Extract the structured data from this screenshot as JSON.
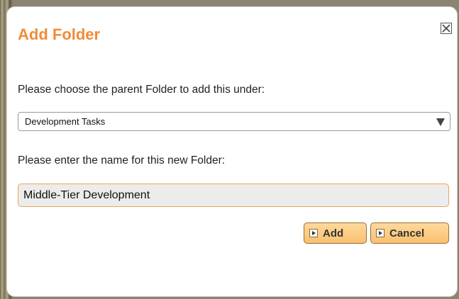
{
  "dialog": {
    "title": "Add Folder",
    "close_icon": "close-icon"
  },
  "parent_folder": {
    "label": "Please choose the parent Folder to add this under:",
    "selected_value": "Development Tasks",
    "arrow_icon": "chevron-down-icon"
  },
  "folder_name": {
    "label": "Please enter the name for this new Folder:",
    "value": "Middle-Tier Development"
  },
  "buttons": {
    "add_label": "Add",
    "cancel_label": "Cancel",
    "arrow_icon": "play-arrow-icon"
  },
  "colors": {
    "title": "#f08c37",
    "button_fill": "#f9c06f",
    "input_border": "#f0a45c"
  }
}
